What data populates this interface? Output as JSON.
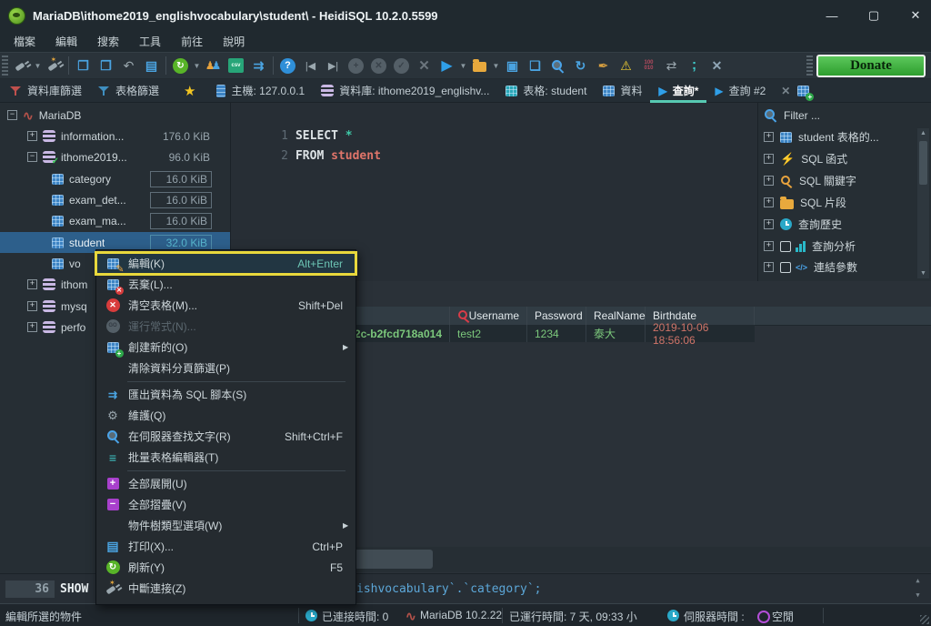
{
  "window": {
    "title": "MariaDB\\ithome2019_englishvocabulary\\student\\ - HeidiSQL 10.2.0.5599"
  },
  "menubar": [
    "檔案",
    "編輯",
    "搜索",
    "工具",
    "前往",
    "說明"
  ],
  "toolbar": {
    "donate": "Donate",
    "csv": "csv",
    "binary_top": "100",
    "binary_bottom": "010"
  },
  "tabbar": {
    "db_filter": "資料庫篩選",
    "table_filter": "表格篩選",
    "tab_host": "主機: 127.0.0.1",
    "tab_db": "資料庫: ithome2019_englishv...",
    "tab_table": "表格: student",
    "tab_data": "資料",
    "tab_query": "查詢*",
    "tab_query2": "查詢 #2"
  },
  "tree": {
    "root": "MariaDB",
    "items": [
      {
        "label": "information...",
        "size": "176.0 KiB"
      },
      {
        "label": "ithome2019...",
        "size": "96.0 KiB"
      },
      {
        "label": "category",
        "size": "16.0 KiB"
      },
      {
        "label": "exam_det...",
        "size": "16.0 KiB"
      },
      {
        "label": "exam_ma...",
        "size": "16.0 KiB"
      },
      {
        "label": "student",
        "size": "32.0 KiB"
      },
      {
        "label": "vo"
      },
      {
        "label": "ithom"
      },
      {
        "label": "mysq"
      },
      {
        "label": "perfo"
      }
    ]
  },
  "editor": {
    "line1_num": "1",
    "line1_kw": "SELECT",
    "line1_rest": "*",
    "line2_num": "2",
    "line2_kw": "FROM",
    "line2_rest": "student"
  },
  "helper": {
    "filter": "Filter ...",
    "items": [
      {
        "label": "student 表格的..."
      },
      {
        "label": "SQL 函式"
      },
      {
        "label": "SQL 關鍵字"
      },
      {
        "label": "SQL 片段"
      },
      {
        "label": "查詢歷史"
      },
      {
        "label": "查詢分析"
      },
      {
        "label": "連結參數"
      }
    ]
  },
  "grid": {
    "columns": [
      "Username",
      "Password",
      "RealName",
      "Birthdate"
    ],
    "row": {
      "id": "a62c-b2fcd718a014",
      "username": "test2",
      "password": "1234",
      "realname": "泰大",
      "birthdate": "2019-10-06 18:56:06"
    }
  },
  "context_menu": {
    "items": [
      {
        "label": "編輯(K)",
        "shortcut": "Alt+Enter"
      },
      {
        "label": "丟棄(L)..."
      },
      {
        "label": "清空表格(M)...",
        "shortcut": "Shift+Del"
      },
      {
        "label": "運行常式(N)..."
      },
      {
        "label": "創建新的(O)"
      },
      {
        "label": "清除資料分頁篩選(P)"
      },
      {
        "label": "匯出資料為 SQL 腳本(S)"
      },
      {
        "label": "維護(Q)"
      },
      {
        "label": "在伺服器查找文字(R)",
        "shortcut": "Shift+Ctrl+F"
      },
      {
        "label": "批量表格編輯器(T)"
      },
      {
        "label": "全部展開(U)"
      },
      {
        "label": "全部摺疊(V)"
      },
      {
        "label": "物件樹類型選項(W)"
      },
      {
        "label": "打印(X)...",
        "shortcut": "Ctrl+P"
      },
      {
        "label": "刷新(Y)",
        "shortcut": "F5"
      },
      {
        "label": "中斷連接(Z)"
      }
    ]
  },
  "log": {
    "line_num": "36",
    "keyword": "SHOW",
    "tail": "ishvocabulary`.`category`;"
  },
  "statusbar": {
    "hint": "編輯所選的物件",
    "connected": "已連接時間: 0",
    "server": "MariaDB 10.2.22",
    "uptime": "已運行時間: 7 天, 09:33 小",
    "server_time_label": "伺服器時間 : ",
    "idle": "空閒"
  },
  "colors": {
    "accent_teal": "#57c9b2",
    "selection_blue": "#2d5f8b",
    "highlight_yellow": "#e8d83c",
    "value_green": "#7cc87c",
    "value_red": "#d07468",
    "identifier_blue": "#5ca7d8",
    "donate_green": "#3db53d"
  }
}
